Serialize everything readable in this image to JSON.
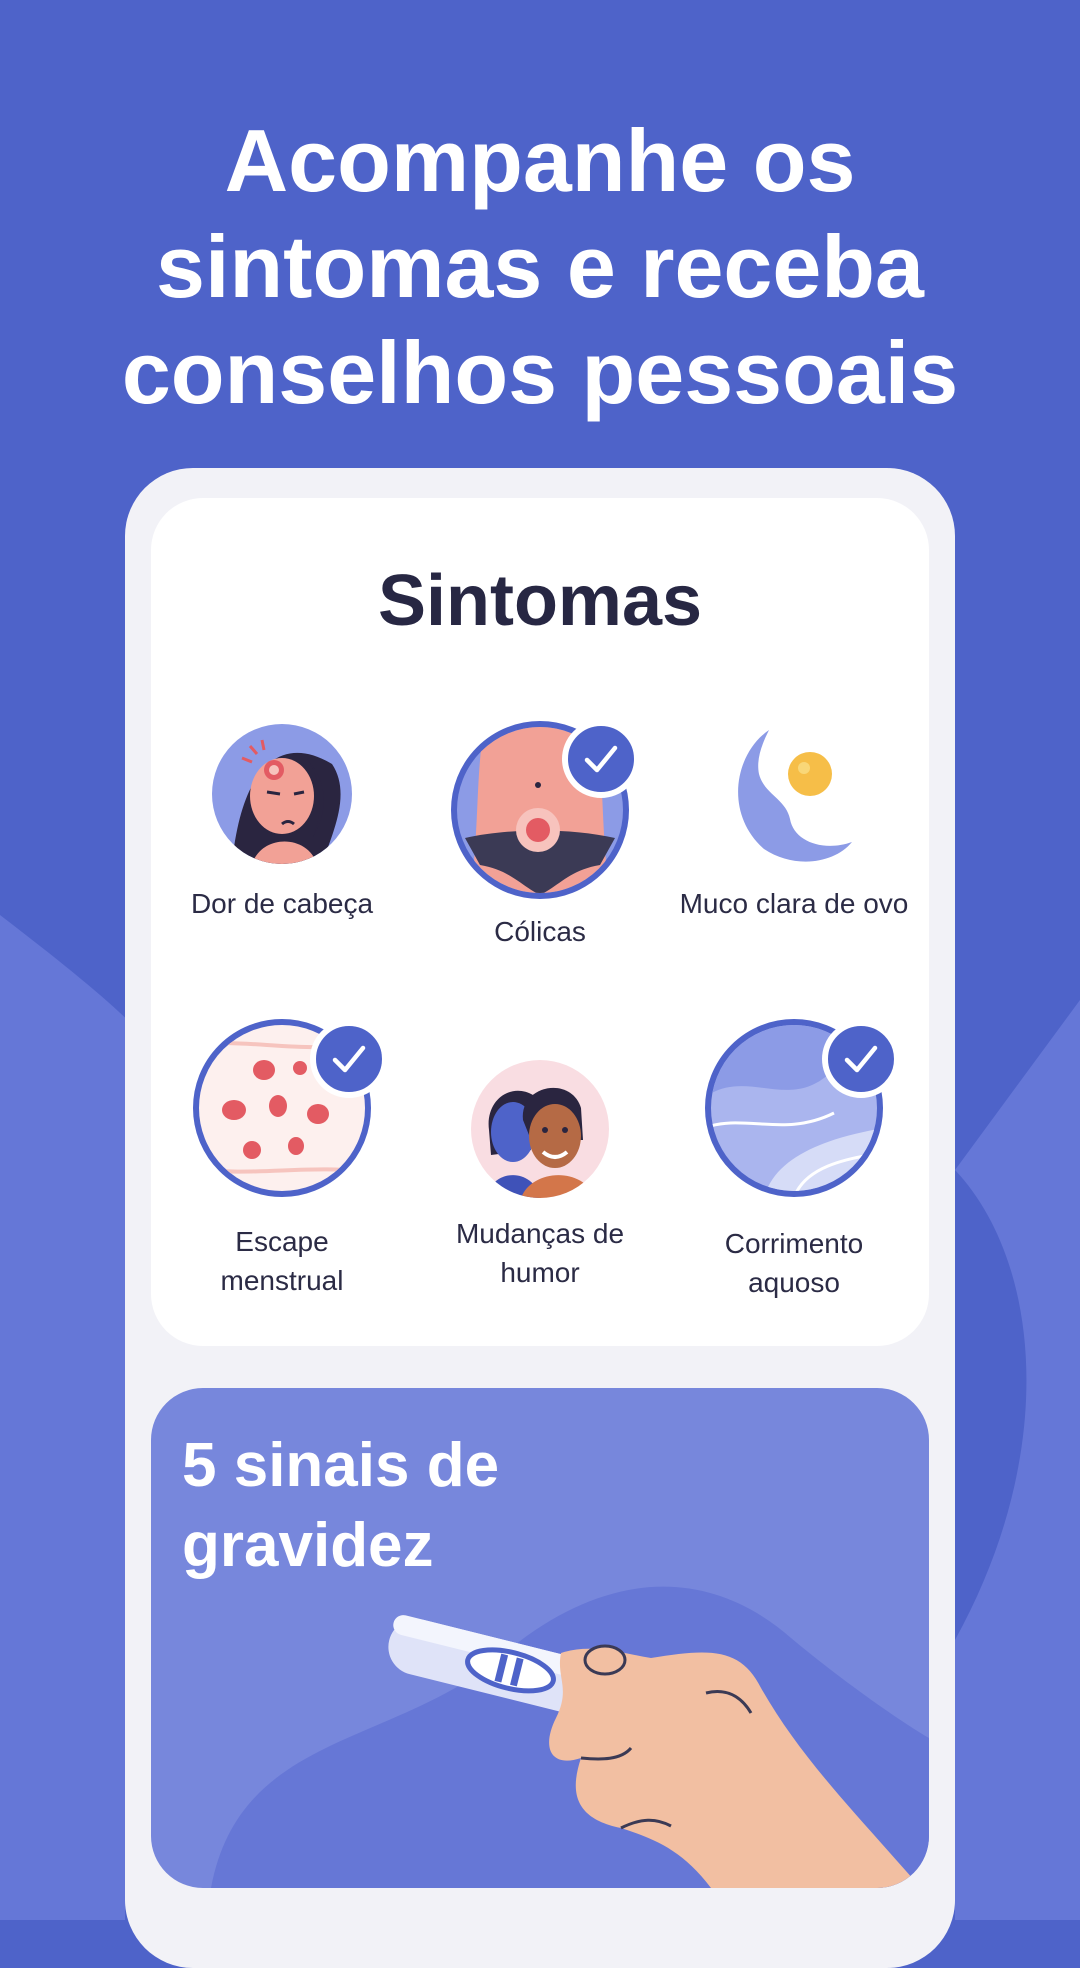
{
  "headline": {
    "line1": "Acompanhe os",
    "line2": "sintomas e receba",
    "line3": "conselhos pessoais"
  },
  "symptoms_card": {
    "title": "Sintomas",
    "items": [
      {
        "label_line1": "Dor de cabeça",
        "label_line2": "",
        "checked": false,
        "icon": "headache-icon"
      },
      {
        "label_line1": "Cólicas",
        "label_line2": "",
        "checked": true,
        "icon": "cramps-icon"
      },
      {
        "label_line1": "Muco clara de ovo",
        "label_line2": "",
        "checked": false,
        "icon": "egg-white-mucus-icon"
      },
      {
        "label_line1": "Escape",
        "label_line2": "menstrual",
        "checked": true,
        "icon": "spotting-icon"
      },
      {
        "label_line1": "Mudanças de",
        "label_line2": "humor",
        "checked": false,
        "icon": "mood-swings-icon"
      },
      {
        "label_line1": "Corrimento",
        "label_line2": "aquoso",
        "checked": true,
        "icon": "watery-discharge-icon"
      }
    ]
  },
  "pregnancy_card": {
    "title_line1": "5 sinais de",
    "title_line2": "gravidez",
    "icon": "pregnancy-test-icon"
  },
  "colors": {
    "background": "#4e63c9",
    "accent": "#4e63c9",
    "card_light": "#7787dc",
    "text_dark": "#272743"
  }
}
